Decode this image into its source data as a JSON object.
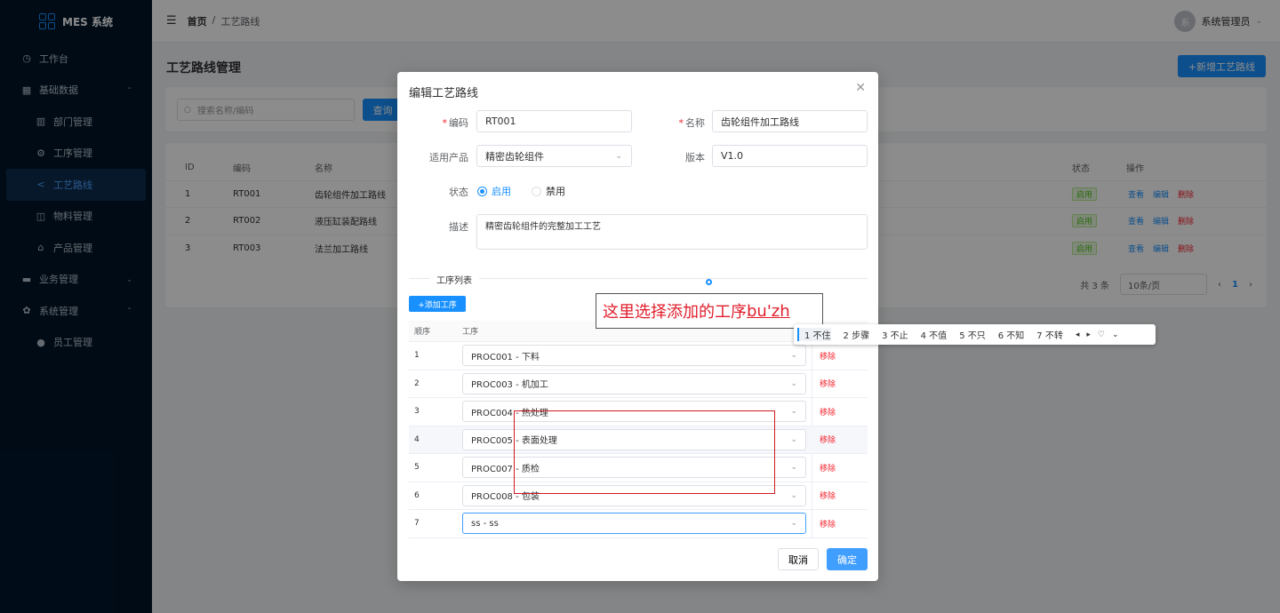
{
  "app": {
    "logo_text": "MES 系统"
  },
  "sidebar": {
    "items": [
      {
        "label": "工作台",
        "icon": "dashboard-icon"
      },
      {
        "label": "基础数据",
        "icon": "grid-icon",
        "arrow": "⌃"
      },
      {
        "label": "部门管理",
        "icon": "building-icon"
      },
      {
        "label": "工序管理",
        "icon": "gear-icon"
      },
      {
        "label": "工艺路线",
        "icon": "share-icon"
      },
      {
        "label": "物料管理",
        "icon": "box-icon"
      },
      {
        "label": "产品管理",
        "icon": "bag-icon"
      },
      {
        "label": "业务管理",
        "icon": "briefcase-icon",
        "arrow": "⌄"
      },
      {
        "label": "系统管理",
        "icon": "settings-icon",
        "arrow": "⌃"
      },
      {
        "label": "员工管理",
        "icon": "user-icon"
      }
    ]
  },
  "topbar": {
    "breadcrumb_home": "首页",
    "breadcrumb_sep": "/",
    "breadcrumb_current": "工艺路线",
    "user_name": "系统管理员",
    "avatar_text": "系"
  },
  "page": {
    "title": "工艺路线管理",
    "add_button": "+新增工艺路线",
    "search_placeholder": "搜索名称/编码",
    "search_button": "查询"
  },
  "table": {
    "headers": {
      "id": "ID",
      "code": "编码",
      "name": "名称",
      "status": "状态",
      "action": "操作"
    },
    "rows": [
      {
        "id": "1",
        "code": "RT001",
        "name": "齿轮组件加工路线",
        "status": "启用"
      },
      {
        "id": "2",
        "code": "RT002",
        "name": "液压缸装配路线",
        "status": "启用"
      },
      {
        "id": "3",
        "code": "RT003",
        "name": "法兰加工路线",
        "status": "启用"
      }
    ],
    "actions": {
      "view": "查看",
      "edit": "编辑",
      "delete": "删除"
    },
    "pager": {
      "total": "共 3 条",
      "page_size": "10条/页",
      "current": "1"
    }
  },
  "modal": {
    "title": "编辑工艺路线",
    "fields": {
      "code_label": "编码",
      "code_value": "RT001",
      "name_label": "名称",
      "name_value": "齿轮组件加工路线",
      "product_label": "适用产品",
      "product_value": "精密齿轮组件",
      "version_label": "版本",
      "version_value": "V1.0",
      "status_label": "状态",
      "status_on": "启用",
      "status_off": "禁用",
      "desc_label": "描述",
      "desc_value": "精密齿轮组件的完整加工工艺"
    },
    "process_section": "工序列表",
    "add_process": "+添加工序",
    "process_headers": {
      "order": "顺序",
      "process": "工序"
    },
    "processes": [
      {
        "order": "1",
        "value": "PROC001 - 下料"
      },
      {
        "order": "2",
        "value": "PROC003 - 机加工"
      },
      {
        "order": "3",
        "value": "PROC004 - 热处理"
      },
      {
        "order": "4",
        "value": "PROC005 - 表面处理"
      },
      {
        "order": "5",
        "value": "PROC007 - 质检"
      },
      {
        "order": "6",
        "value": "PROC008 - 包装"
      },
      {
        "order": "7",
        "value": "ss - ss"
      }
    ],
    "remove_label": "移除",
    "cancel": "取消",
    "ok": "确定"
  },
  "annotation": {
    "text": "这里选择添加的工序",
    "composing": "bu'zh"
  },
  "ime": {
    "candidates": [
      "1 不住",
      "2 步骤",
      "3 不止",
      "4 不值",
      "5 不只",
      "6 不知",
      "7 不转"
    ]
  }
}
